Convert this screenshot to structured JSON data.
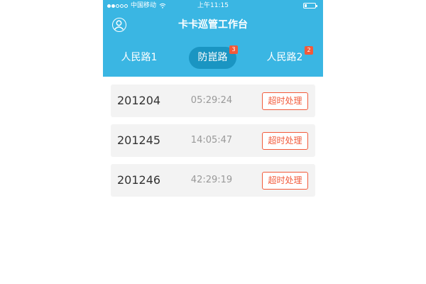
{
  "status_bar": {
    "carrier": "中国移动",
    "time": "上午11:15",
    "signal_icon": "signal-dots-icon",
    "wifi_icon": "wifi-icon",
    "battery_icon": "battery-icon"
  },
  "header": {
    "title": "卡卡巡管工作台",
    "avatar_icon": "user-avatar-icon",
    "background_color": "#3ab6e3"
  },
  "tabs": [
    {
      "label": "人民路1",
      "badge": ""
    },
    {
      "label": "防崑路",
      "badge": "3",
      "selected": true
    },
    {
      "label": "人民路2",
      "badge": "2"
    }
  ],
  "rows": [
    {
      "code": "201204",
      "time": "05:29:24",
      "action": "超时处理"
    },
    {
      "code": "201245",
      "time": "14:05:47",
      "action": "超时处理"
    },
    {
      "code": "201246",
      "time": "42:29:19",
      "action": "超时处理"
    }
  ],
  "colors": {
    "accent": "#3ab6e3",
    "selected_tab": "#1a95c2",
    "badge": "#f25a3a",
    "action": "#f25a3a"
  }
}
